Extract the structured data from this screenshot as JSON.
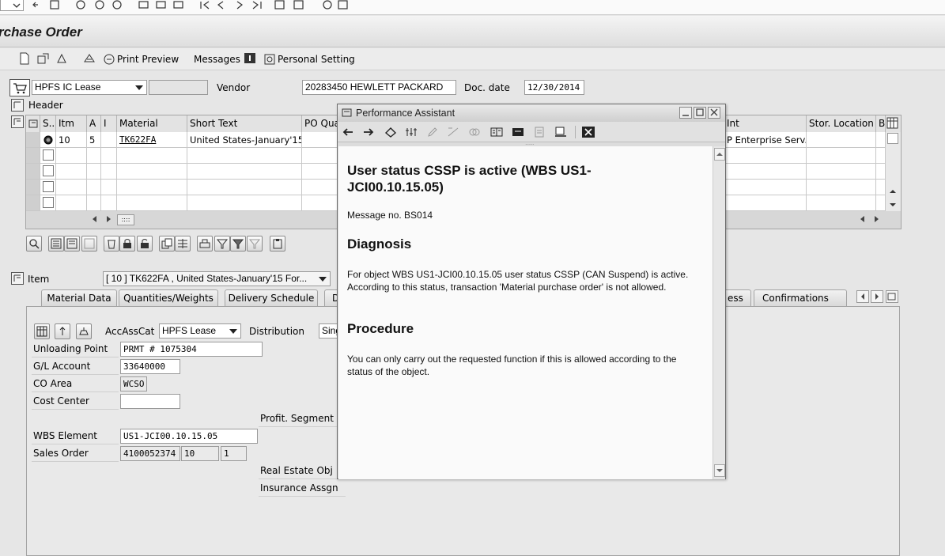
{
  "window": {
    "title": "rchase Order"
  },
  "app_toolbar": {
    "print_preview": "Print Preview",
    "messages": "Messages",
    "personal_setting": "Personal Setting"
  },
  "header": {
    "po_type": "HPFS IC Lease",
    "vendor_label": "Vendor",
    "vendor_value": "20283450 HEWLETT PACKARD",
    "doc_date_label": "Doc. date",
    "doc_date_value": "12/30/2014",
    "section_label": "Header"
  },
  "item_grid": {
    "columns": [
      "S..",
      "Itm",
      "A",
      "I",
      "Material",
      "Short Text",
      "PO Qua",
      "Int",
      "Stor. Location",
      "B"
    ],
    "rows": [
      {
        "itm": "10",
        "a": "5",
        "i": "",
        "material": "TK622FA",
        "short_text": "United States-January'15...",
        "plant": "P Enterprise Serv...",
        "stor": ""
      }
    ]
  },
  "item_detail": {
    "label": "Item",
    "selected": "[ 10 ] TK622FA , United States-January'15 For...",
    "tabs": [
      "Material Data",
      "Quantities/Weights",
      "Delivery Schedule",
      "D",
      "ess",
      "Confirmations"
    ]
  },
  "account_assignment": {
    "accasscat_label": "AccAssCat",
    "accasscat_value": "HPFS Lease",
    "distribution_label": "Distribution",
    "distribution_value": "Sing",
    "unloading_point_label": "Unloading Point",
    "unloading_point_value": "PRMT # 1075304",
    "gl_account_label": "G/L Account",
    "gl_account_value": "33640000",
    "co_area_label": "CO Area",
    "co_area_value": "WCSO",
    "cost_center_label": "Cost Center",
    "cost_center_value": "",
    "profit_segment_label": "Profit. Segment",
    "wbs_label": "WBS Element",
    "wbs_value": "US1-JCI00.10.15.05",
    "sales_order_label": "Sales Order",
    "sales_order_value": "4100052374",
    "sales_order_item": "10",
    "sales_order_sched": "1",
    "real_estate_label": "Real Estate Obj",
    "insurance_label": "Insurance Assgn"
  },
  "performance_assistant": {
    "title": "Performance Assistant",
    "heading": "User status CSSP is active (WBS US1-JCI00.10.15.05)",
    "message_no": "Message no. BS014",
    "diagnosis_heading": "Diagnosis",
    "diagnosis_text": "For object WBS US1-JCI00.10.15.05 user status CSSP (CAN Suspend) is active.  According to this status, transaction 'Material purchase order' is not allowed.",
    "procedure_heading": "Procedure",
    "procedure_text": "You can only carry out the requested function if this is allowed according to the status of the object."
  }
}
